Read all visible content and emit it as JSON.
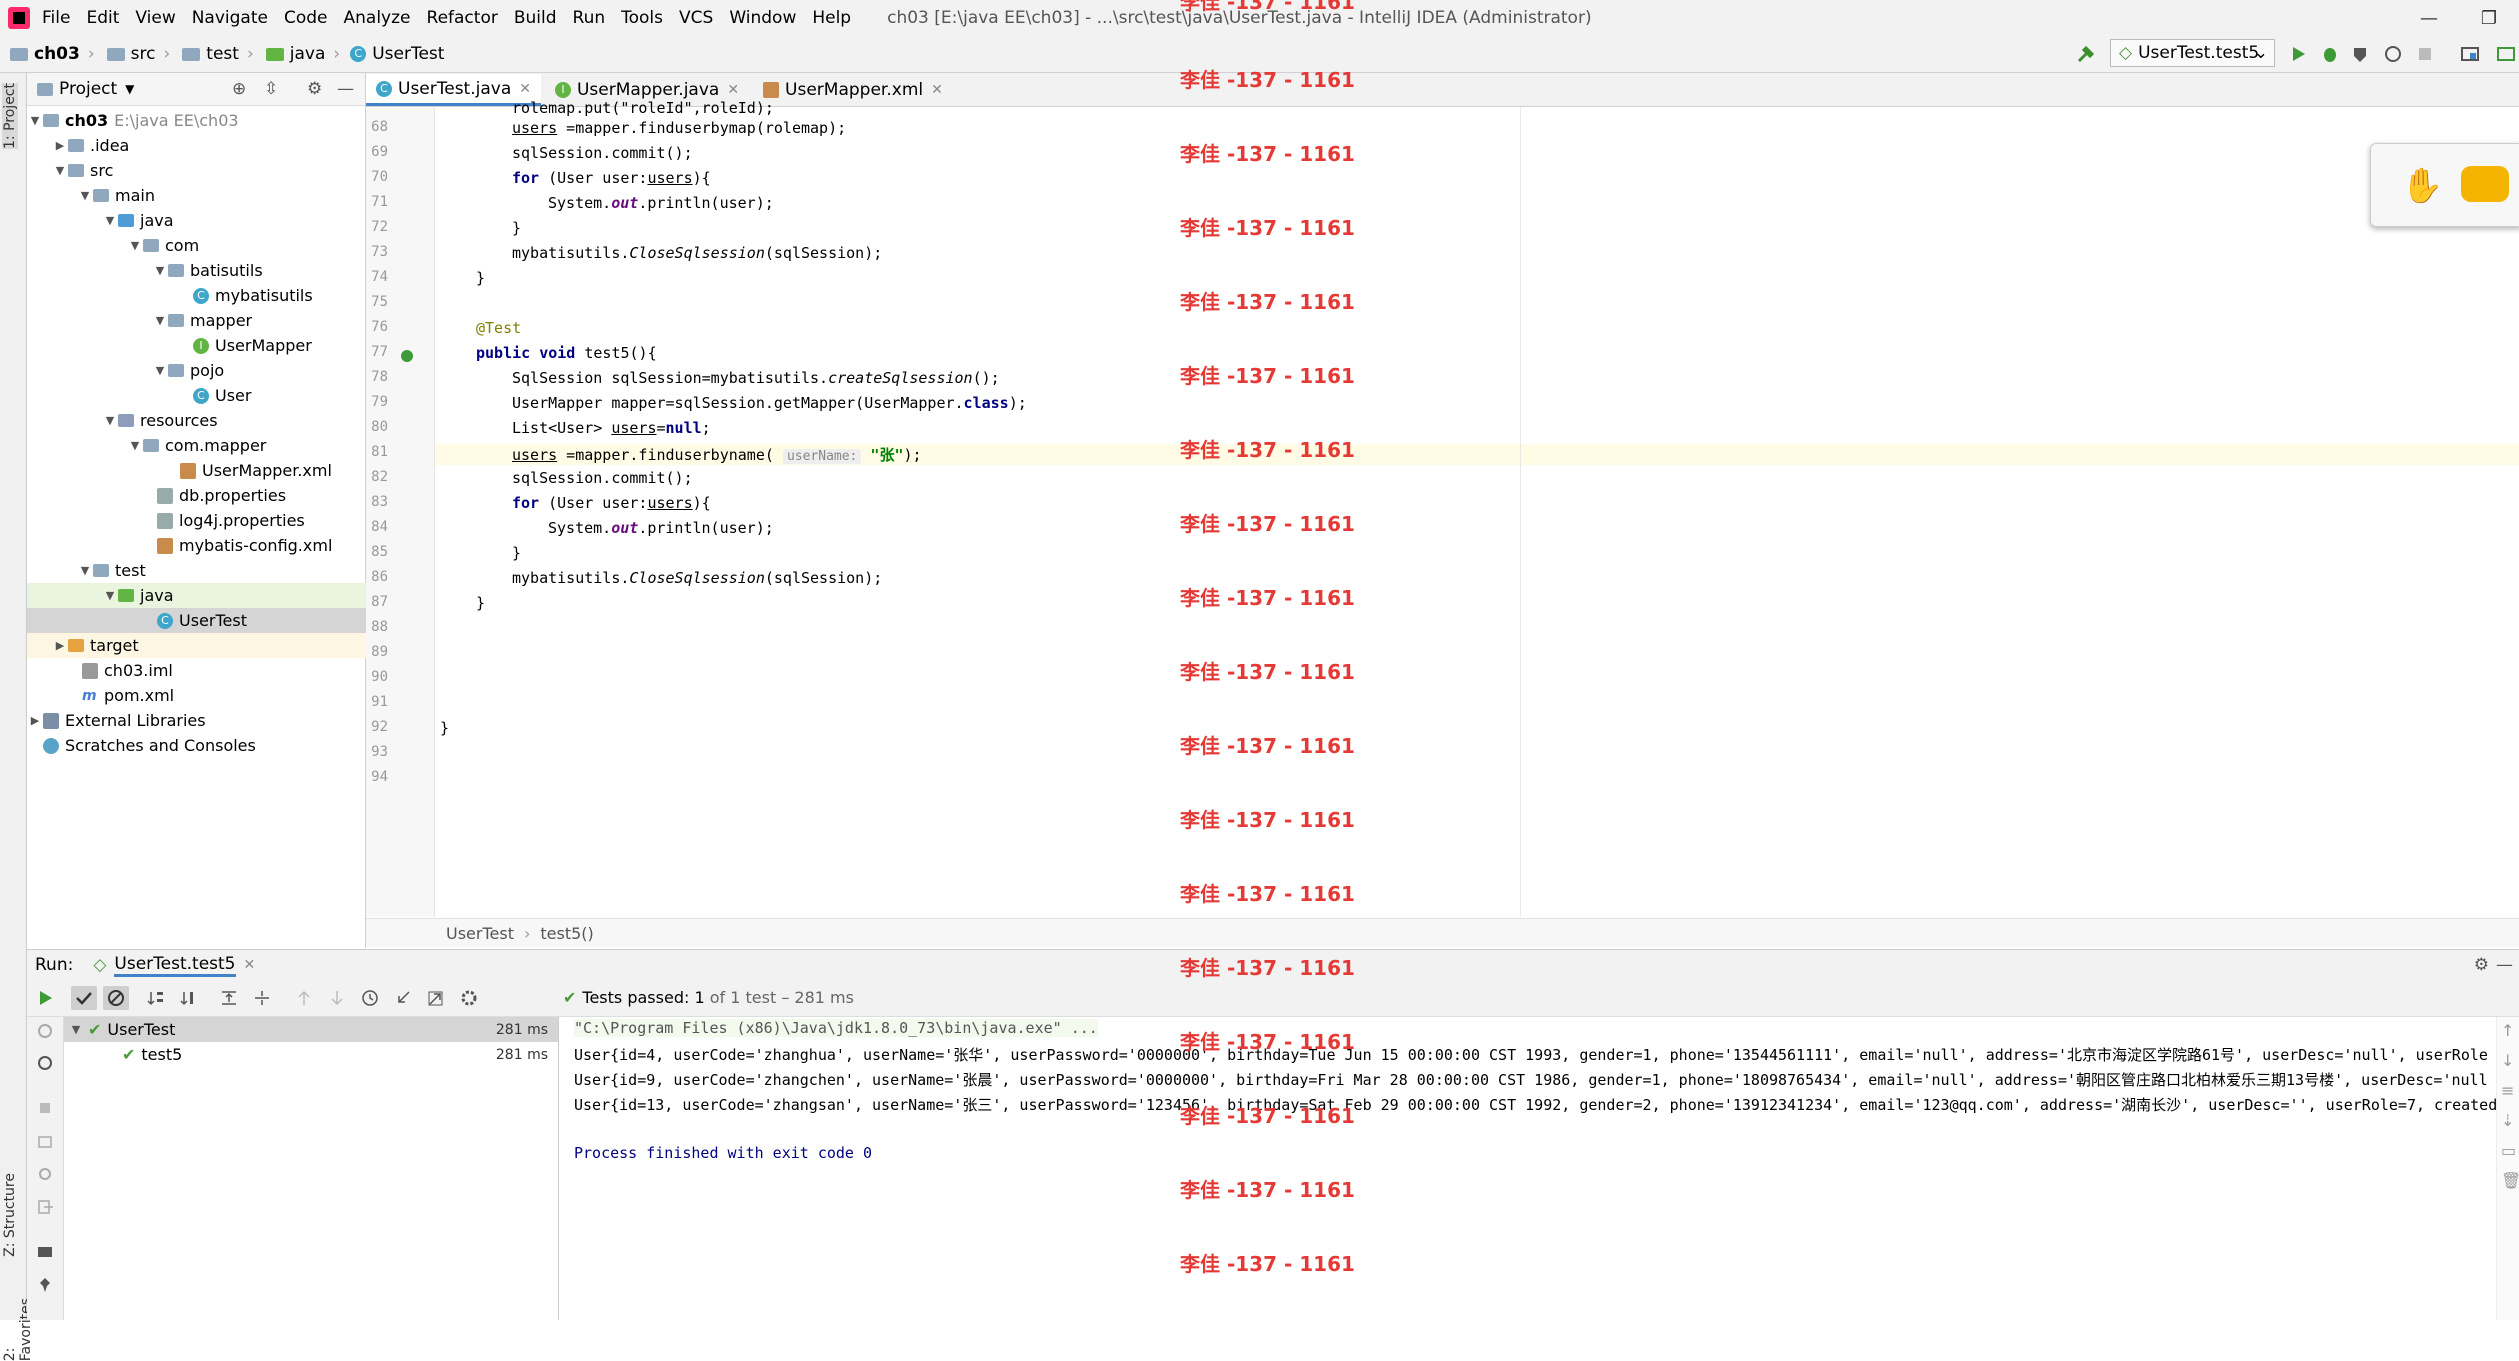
{
  "menubar": {
    "items": [
      "File",
      "Edit",
      "View",
      "Navigate",
      "Code",
      "Analyze",
      "Refactor",
      "Build",
      "Run",
      "Tools",
      "VCS",
      "Window",
      "Help"
    ],
    "title": "ch03 [E:\\java EE\\ch03] - ...\\src\\test\\java\\UserTest.java - IntelliJ IDEA (Administrator)"
  },
  "navbar": {
    "crumbs": [
      "ch03",
      "src",
      "test",
      "java",
      "UserTest"
    ],
    "run_config": "UserTest.test5"
  },
  "left_strip": {
    "project_label": "1: Project",
    "structure_label": "Z: Structure",
    "favorites_label": "2: Favorites"
  },
  "project_panel": {
    "title": "Project",
    "tree": [
      {
        "label": "ch03",
        "extra": "E:\\java EE\\ch03"
      },
      {
        "label": ".idea"
      },
      {
        "label": "src"
      },
      {
        "label": "main"
      },
      {
        "label": "java"
      },
      {
        "label": "com"
      },
      {
        "label": "batisutils"
      },
      {
        "label": "mybatisutils"
      },
      {
        "label": "mapper"
      },
      {
        "label": "UserMapper"
      },
      {
        "label": "pojo"
      },
      {
        "label": "User"
      },
      {
        "label": "resources"
      },
      {
        "label": "com.mapper"
      },
      {
        "label": "UserMapper.xml"
      },
      {
        "label": "db.properties"
      },
      {
        "label": "log4j.properties"
      },
      {
        "label": "mybatis-config.xml"
      },
      {
        "label": "test"
      },
      {
        "label": "java"
      },
      {
        "label": "UserTest"
      },
      {
        "label": "target"
      },
      {
        "label": "ch03.iml"
      },
      {
        "label": "pom.xml"
      },
      {
        "label": "External Libraries"
      },
      {
        "label": "Scratches and Consoles"
      }
    ]
  },
  "editor": {
    "tabs": [
      "UserTest.java",
      "UserMapper.java",
      "UserMapper.xml"
    ],
    "line_numbers": [
      "68",
      "69",
      "70",
      "71",
      "72",
      "73",
      "74",
      "75",
      "76",
      "77",
      "78",
      "79",
      "80",
      "81",
      "82",
      "83",
      "84",
      "85",
      "86",
      "87",
      "88",
      "89",
      "90",
      "91",
      "92",
      "93",
      "94"
    ],
    "code": {
      "l67": "rolemap.put(\"roleId\",roleId);",
      "users": "users",
      "l68_rest": " =mapper.finduserbymap(rolemap);",
      "l69": "sqlSession.commit();",
      "for_kw": "for",
      "for_rest": " (User user:",
      "for_end": "){",
      "sys": "System.",
      "out": "out",
      "println": ".println(user);",
      "close_brace": "}",
      "close_a": "mybatisutils.",
      "close_b": "CloseSqlsession",
      "close_c": "(sqlSession);",
      "annotation": "@Test",
      "public_kw": "public void",
      "method": " test5(){",
      "l78_a": "SqlSession sqlSession=mybatisutils.",
      "l78_b": "createSqlsession",
      "l78_c": "();",
      "l79_a": "UserMapper mapper=sqlSession.getMapper(UserMapper.",
      "l79_kw": "class",
      "l79_c": ");",
      "l80_a": "List<User> ",
      "l80_b": "=",
      "null_kw": "null",
      "l80_c": ";",
      "l81_a": " =mapper.finduserbyname( ",
      "l81_hint": "userName:",
      "l81_str": "\"张\"",
      "l81_c": ");"
    },
    "breadcrumb": [
      "UserTest",
      "test5()"
    ]
  },
  "watermark": "李佳 -137 - 1161",
  "run_panel": {
    "run_label": "Run:",
    "tab": "UserTest.test5",
    "status_prefix": "Tests passed: ",
    "status_count": "1",
    "status_suffix": " of 1 test – 281 ms",
    "tree": [
      {
        "name": "UserTest",
        "time": "281 ms"
      },
      {
        "name": "test5",
        "time": "281 ms"
      }
    ],
    "console": [
      "\"C:\\Program Files (x86)\\Java\\jdk1.8.0_73\\bin\\java.exe\" ...",
      "User{id=4, userCode='zhanghua', userName='张华', userPassword='0000000', birthday=Tue Jun 15 00:00:00 CST 1993, gender=1, phone='13544561111', email='null', address='北京市海淀区学院路61号', userDesc='null', userRole",
      "User{id=9, userCode='zhangchen', userName='张晨', userPassword='0000000', birthday=Fri Mar 28 00:00:00 CST 1986, gender=1, phone='18098765434', email='null', address='朝阳区管庄路口北柏林爱乐三期13号楼', userDesc='null",
      "User{id=13, userCode='zhangsan', userName='张三', userPassword='123456', birthday=Sat Feb 29 00:00:00 CST 1992, gender=2, phone='13912341234', email='123@qq.com', address='湖南长沙', userDesc='', userRole=7, created",
      "",
      "Process finished with exit code 0"
    ]
  }
}
